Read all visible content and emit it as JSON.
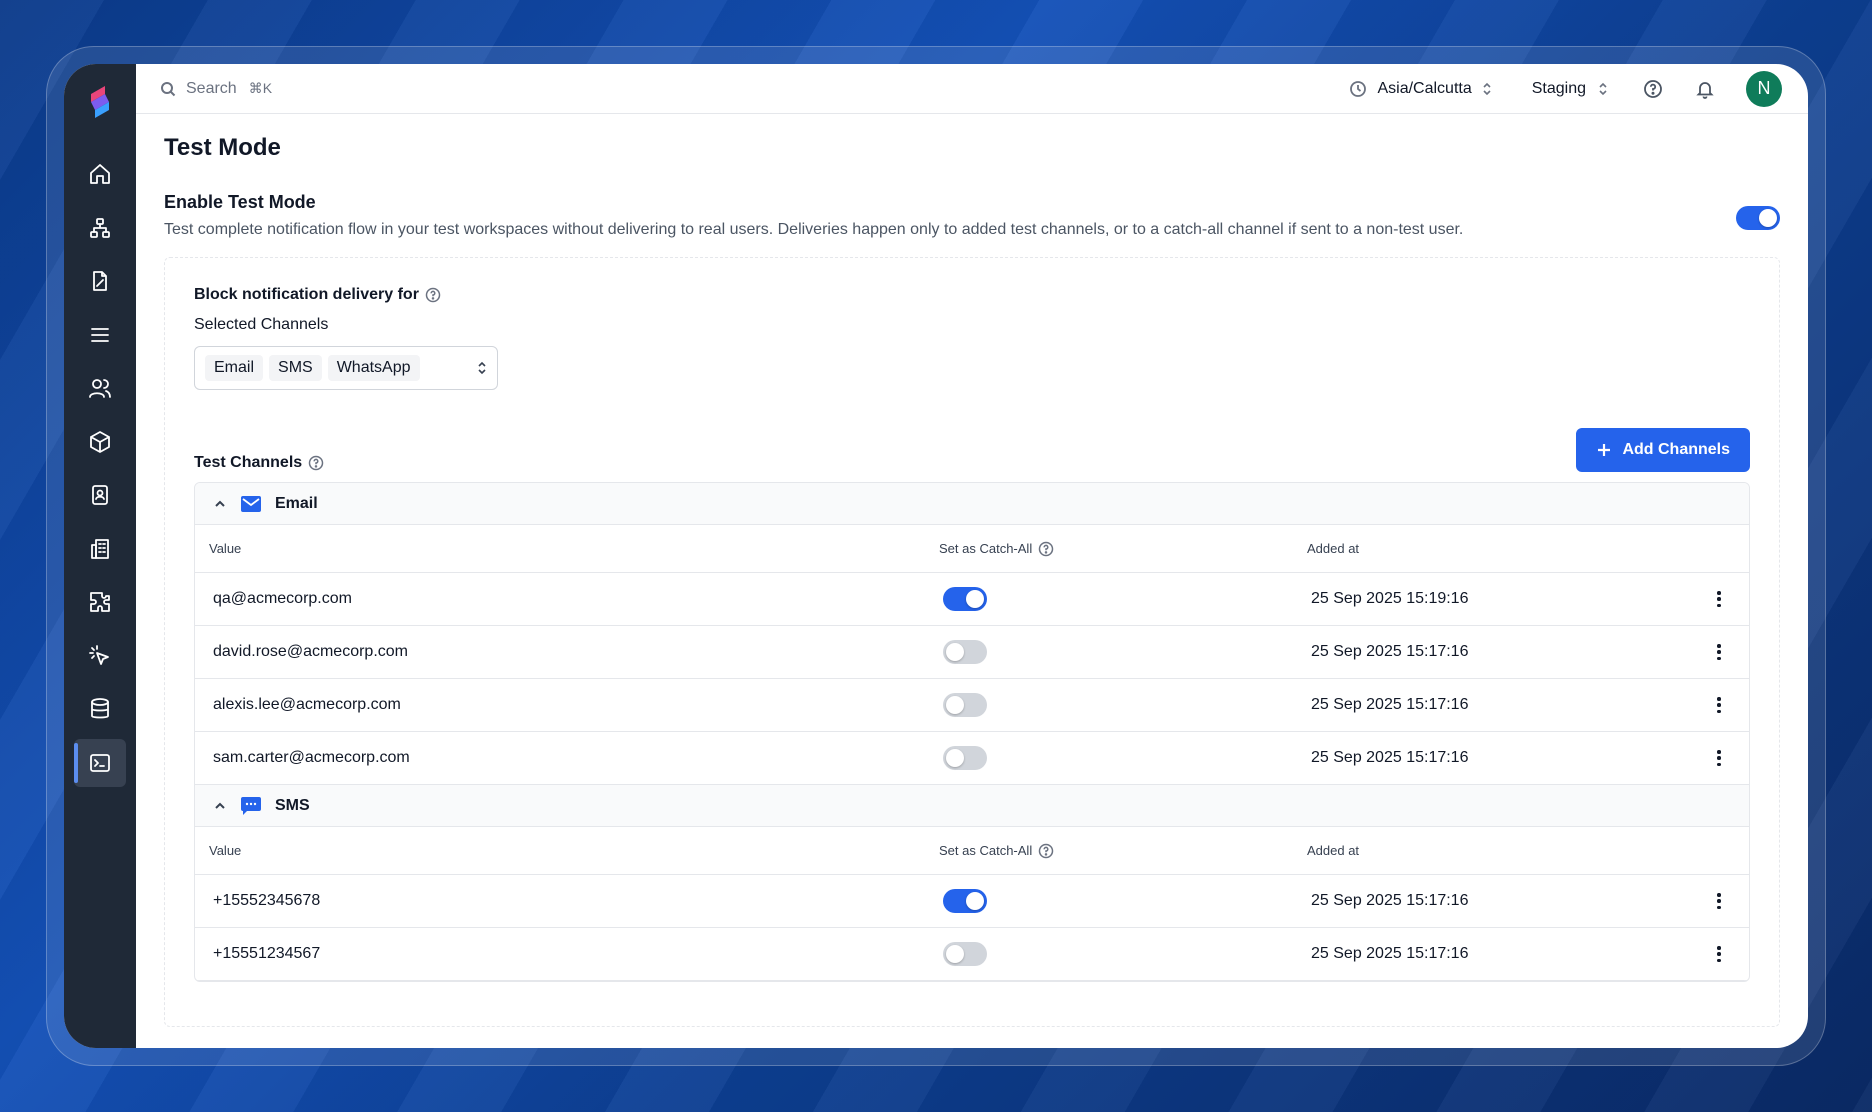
{
  "search": {
    "placeholder": "Search",
    "shortcut": "⌘K"
  },
  "topbar": {
    "timezone": "Asia/Calcutta",
    "environment": "Staging",
    "avatar_initial": "N"
  },
  "page": {
    "title": "Test Mode",
    "enable_title": "Enable Test Mode",
    "enable_description": "Test complete notification flow in your test workspaces without delivering to real users. Deliveries happen only to added test channels, or to a catch-all channel if sent to a non-test user.",
    "enabled": true
  },
  "block": {
    "title": "Block notification delivery for",
    "selected_label": "Selected Channels",
    "chips": [
      "Email",
      "SMS",
      "WhatsApp"
    ]
  },
  "test_channels": {
    "title": "Test Channels",
    "add_button": "Add Channels",
    "columns": {
      "value": "Value",
      "catch_all": "Set as Catch-All",
      "added_at": "Added at"
    },
    "groups": [
      {
        "name": "Email",
        "icon": "mail-icon",
        "rows": [
          {
            "value": "qa@acmecorp.com",
            "catch_all": true,
            "added_at": "25 Sep 2025 15:19:16"
          },
          {
            "value": "david.rose@acmecorp.com",
            "catch_all": false,
            "added_at": "25 Sep 2025 15:17:16"
          },
          {
            "value": "alexis.lee@acmecorp.com",
            "catch_all": false,
            "added_at": "25 Sep 2025 15:17:16"
          },
          {
            "value": "sam.carter@acmecorp.com",
            "catch_all": false,
            "added_at": "25 Sep 2025 15:17:16"
          }
        ]
      },
      {
        "name": "SMS",
        "icon": "sms-icon",
        "rows": [
          {
            "value": "+15552345678",
            "catch_all": true,
            "added_at": "25 Sep 2025 15:17:16"
          },
          {
            "value": "+15551234567",
            "catch_all": false,
            "added_at": "25 Sep 2025 15:17:16"
          }
        ]
      }
    ]
  },
  "colors": {
    "accent": "#2563eb",
    "sidebar": "#1f2937",
    "avatar": "#0f7c5a"
  }
}
